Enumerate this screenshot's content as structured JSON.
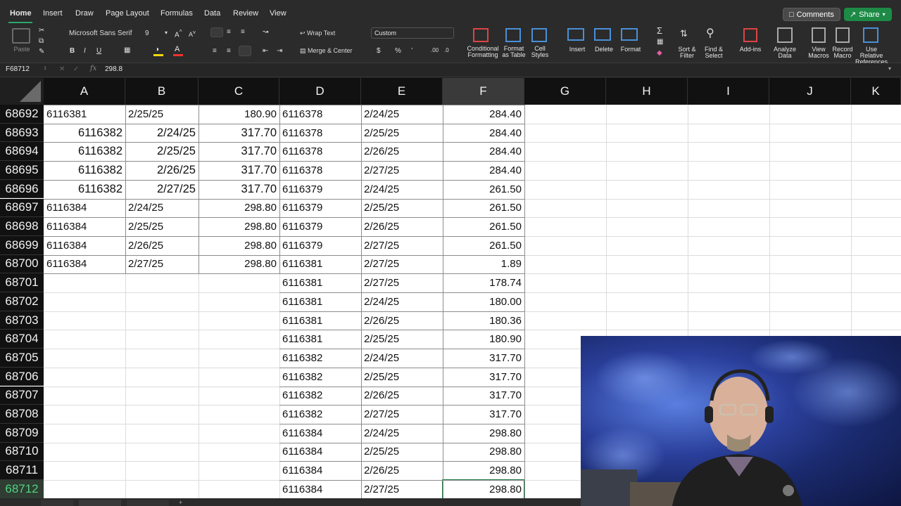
{
  "ribbon_tabs": [
    "Home",
    "Insert",
    "Draw",
    "Page Layout",
    "Formulas",
    "Data",
    "Review",
    "View"
  ],
  "top_buttons": {
    "comments": "Comments",
    "share": "Share"
  },
  "clipboard": {
    "paste": "Paste"
  },
  "font": {
    "name": "Microsoft Sans Serif",
    "size": "9"
  },
  "alignment": {
    "wrap_text": "Wrap Text",
    "merge_center": "Merge & Center"
  },
  "number_format": {
    "format": "Custom",
    "currency": "$",
    "percent": "%"
  },
  "styles": {
    "conditional_formatting": "Conditional Formatting",
    "format_as_table": "Format as Table",
    "cell_styles": "Cell Styles"
  },
  "cells_group": {
    "insert": "Insert",
    "delete": "Delete",
    "format": "Format"
  },
  "editing": {
    "sort_filter": "Sort & Filter",
    "find_select": "Find & Select"
  },
  "addins": {
    "add_ins": "Add-ins",
    "analyze_data": "Analyze Data"
  },
  "macros": {
    "view_macros": "View Macros",
    "record_macro": "Record Macro",
    "use_relative": "Use Relative References"
  },
  "formula_bar": {
    "name_box": "F68712",
    "fx": "fx",
    "value": "298.8"
  },
  "columns": [
    "A",
    "B",
    "C",
    "D",
    "E",
    "F",
    "G",
    "H",
    "I",
    "J",
    "K"
  ],
  "selected_column": "F",
  "selected_row": "68712",
  "rows": [
    {
      "n": "68692",
      "a": "6116381",
      "b": "2/25/25",
      "c": "180.90",
      "d": "6116378",
      "e": "2/24/25",
      "f": "284.40"
    },
    {
      "n": "68693",
      "a": "6116382",
      "b": "2/24/25",
      "c": "317.70",
      "d": "6116378",
      "e": "2/25/25",
      "f": "284.40"
    },
    {
      "n": "68694",
      "a": "6116382",
      "b": "2/25/25",
      "c": "317.70",
      "d": "6116378",
      "e": "2/26/25",
      "f": "284.40"
    },
    {
      "n": "68695",
      "a": "6116382",
      "b": "2/26/25",
      "c": "317.70",
      "d": "6116378",
      "e": "2/27/25",
      "f": "284.40"
    },
    {
      "n": "68696",
      "a": "6116382",
      "b": "2/27/25",
      "c": "317.70",
      "d": "6116379",
      "e": "2/24/25",
      "f": "261.50"
    },
    {
      "n": "68697",
      "a": "6116384",
      "b": "2/24/25",
      "c": "298.80",
      "d": "6116379",
      "e": "2/25/25",
      "f": "261.50"
    },
    {
      "n": "68698",
      "a": "6116384",
      "b": "2/25/25",
      "c": "298.80",
      "d": "6116379",
      "e": "2/26/25",
      "f": "261.50"
    },
    {
      "n": "68699",
      "a": "6116384",
      "b": "2/26/25",
      "c": "298.80",
      "d": "6116379",
      "e": "2/27/25",
      "f": "261.50"
    },
    {
      "n": "68700",
      "a": "6116384",
      "b": "2/27/25",
      "c": "298.80",
      "d": "6116381",
      "e": "2/27/25",
      "f": "1.89"
    },
    {
      "n": "68701",
      "a": "",
      "b": "",
      "c": "",
      "d": "6116381",
      "e": "2/27/25",
      "f": "178.74"
    },
    {
      "n": "68702",
      "a": "",
      "b": "",
      "c": "",
      "d": "6116381",
      "e": "2/24/25",
      "f": "180.00"
    },
    {
      "n": "68703",
      "a": "",
      "b": "",
      "c": "",
      "d": "6116381",
      "e": "2/26/25",
      "f": "180.36"
    },
    {
      "n": "68704",
      "a": "",
      "b": "",
      "c": "",
      "d": "6116381",
      "e": "2/25/25",
      "f": "180.90"
    },
    {
      "n": "68705",
      "a": "",
      "b": "",
      "c": "",
      "d": "6116382",
      "e": "2/24/25",
      "f": "317.70"
    },
    {
      "n": "68706",
      "a": "",
      "b": "",
      "c": "",
      "d": "6116382",
      "e": "2/25/25",
      "f": "317.70"
    },
    {
      "n": "68707",
      "a": "",
      "b": "",
      "c": "",
      "d": "6116382",
      "e": "2/26/25",
      "f": "317.70"
    },
    {
      "n": "68708",
      "a": "",
      "b": "",
      "c": "",
      "d": "6116382",
      "e": "2/27/25",
      "f": "317.70"
    },
    {
      "n": "68709",
      "a": "",
      "b": "",
      "c": "",
      "d": "6116384",
      "e": "2/24/25",
      "f": "298.80"
    },
    {
      "n": "68710",
      "a": "",
      "b": "",
      "c": "",
      "d": "6116384",
      "e": "2/25/25",
      "f": "298.80"
    },
    {
      "n": "68711",
      "a": "",
      "b": "",
      "c": "",
      "d": "6116384",
      "e": "2/26/25",
      "f": "298.80"
    },
    {
      "n": "68712",
      "a": "",
      "b": "",
      "c": "",
      "d": "6116384",
      "e": "2/27/25",
      "f": "298.80"
    }
  ],
  "colors": {
    "accent": "#1d8a46",
    "selection": "#1f7a45"
  }
}
